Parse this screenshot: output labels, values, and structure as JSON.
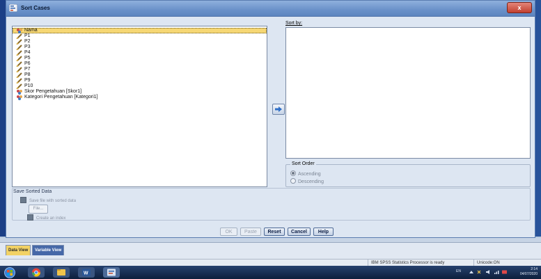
{
  "window": {
    "title": "Sort Cases",
    "close_label": "x"
  },
  "variables": [
    {
      "label": "Nama",
      "type": "nominal",
      "selected": true
    },
    {
      "label": "P1",
      "type": "scale"
    },
    {
      "label": "P2",
      "type": "scale"
    },
    {
      "label": "P3",
      "type": "scale"
    },
    {
      "label": "P4",
      "type": "scale"
    },
    {
      "label": "P5",
      "type": "scale"
    },
    {
      "label": "P6",
      "type": "scale"
    },
    {
      "label": "P7",
      "type": "scale"
    },
    {
      "label": "P8",
      "type": "scale"
    },
    {
      "label": "P9",
      "type": "scale"
    },
    {
      "label": "P10",
      "type": "scale"
    },
    {
      "label": "Skor Pengetahuan [Skor1]",
      "type": "nominal"
    },
    {
      "label": "Kategori Pengetahuan [Kategori1]",
      "type": "nominal"
    }
  ],
  "sort_by": {
    "label": "Sort by:"
  },
  "sort_order": {
    "legend": "Sort Order",
    "options": [
      "Ascending",
      "Descending"
    ],
    "selected": "Ascending"
  },
  "save": {
    "title": "Save Sorted Data",
    "save_file_label": "Save file with sorted data",
    "file_button": "File...",
    "create_index_label": "Create an index"
  },
  "buttons": {
    "ok": "OK",
    "paste": "Paste",
    "reset": "Reset",
    "cancel": "Cancel",
    "help": "Help"
  },
  "tabs": {
    "data_view": "Data View",
    "variable_view": "Variable View"
  },
  "status": {
    "processor": "IBM SPSS Statistics Processor is ready",
    "encoding": "Unicode:ON"
  },
  "tray": {
    "language": "EN",
    "time": "2:14",
    "date": "04/07/2020"
  },
  "colors": {
    "selected_item": "#f6d774",
    "active_tab": "#f2d265",
    "titlebar": "#6a91c9"
  }
}
